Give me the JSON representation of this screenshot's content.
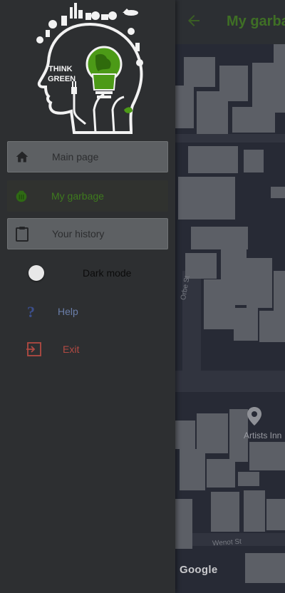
{
  "map": {
    "title": "My garba",
    "street_labels": [
      "Orbe St",
      "Wenot St"
    ],
    "place_label": "Artists Inn",
    "attribution": "Google"
  },
  "drawer": {
    "logo_text_line1": "THINK",
    "logo_text_line2": "GREEN",
    "items": [
      {
        "label": "Main page",
        "icon": "home-icon"
      },
      {
        "label": "My garbage",
        "icon": "garbage-icon"
      },
      {
        "label": "Your history",
        "icon": "clipboard-icon"
      }
    ],
    "dark_mode": {
      "label": "Dark mode",
      "enabled": false
    },
    "help": {
      "label": "Help",
      "icon": "question-icon"
    },
    "exit": {
      "label": "Exit",
      "icon": "exit-icon"
    }
  },
  "colors": {
    "drawer_bg": "#2d2f31",
    "accent_green": "#3e7a1e",
    "help_blue": "#6a7ea9",
    "exit_red": "#b14a43"
  }
}
